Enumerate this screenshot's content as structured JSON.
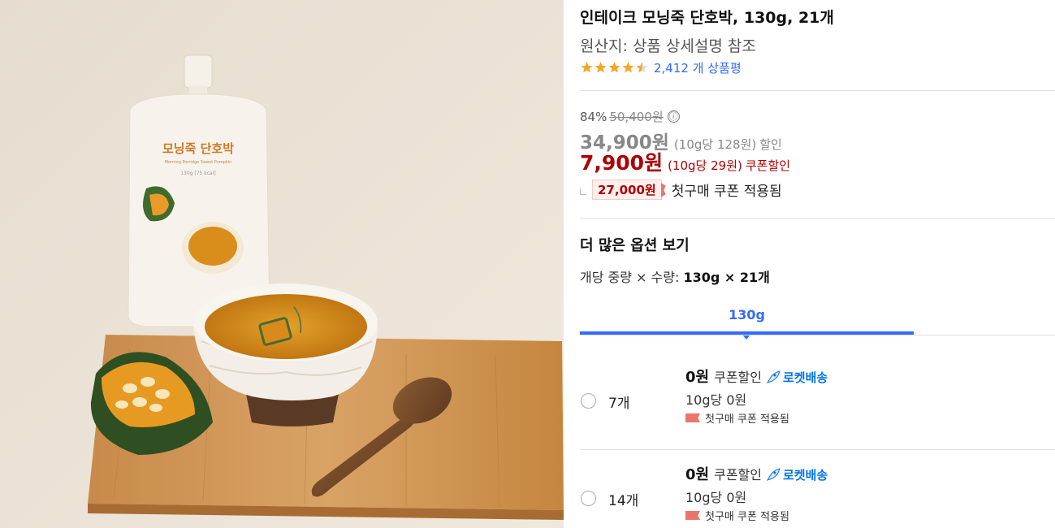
{
  "product": {
    "title": "인테이크 모닝죽 단호박, 130g, 21개",
    "origin": "원산지: 상품 상세설명 참조",
    "rating_value": 4.5,
    "review_count_text": "2,412 개 상품평"
  },
  "package": {
    "name": "모닝죽 단호박",
    "subtitle": "Morning Porridge Sweet Pumpkin",
    "weight": "130g [75 kcal]"
  },
  "pricing": {
    "discount_percent": "84%",
    "original_price": "50,400원",
    "info_icon": "ⓘ",
    "sale_price": "34,900원",
    "sale_unit": "(10g당 128원)",
    "sale_tag": "할인",
    "coupon_price": "7,900원",
    "coupon_unit": "(10g당 29원)",
    "coupon_tag": "쿠폰할인",
    "first_purchase_price": "27,000원",
    "first_purchase_text": "첫구매 쿠폰 적용됨"
  },
  "options": {
    "title": "더 많은 옵션 보기",
    "spec_label": "개당 중량 × 수량:",
    "spec_value": "130g × 21개",
    "tab_label": "130g",
    "items": [
      {
        "qty": "7개",
        "amount": "0원",
        "discount": "쿠폰할인",
        "delivery": "로켓배송",
        "unit_price": "10g당 0원",
        "coupon_note": "첫구매 쿠폰 적용됨"
      },
      {
        "qty": "14개",
        "amount": "0원",
        "discount": "쿠폰할인",
        "delivery": "로켓배송",
        "unit_price": "10g당 0원",
        "coupon_note": "첫구매 쿠폰 적용됨"
      }
    ]
  },
  "colors": {
    "accent_blue": "#346aff",
    "coupon_red": "#ae0000",
    "rocket_blue": "#0073e9",
    "star_orange": "#f5a623"
  }
}
